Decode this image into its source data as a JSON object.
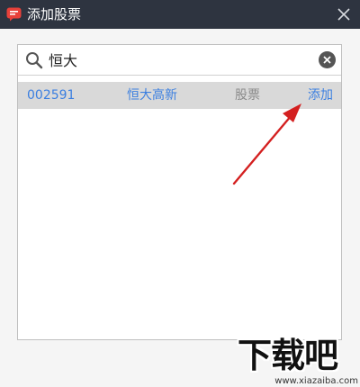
{
  "window": {
    "title": "添加股票",
    "close_icon": "close-icon",
    "app_icon": "chat-bubble-icon"
  },
  "search": {
    "value": "恒大",
    "icon": "search-icon",
    "clear_icon": "clear-icon"
  },
  "results": [
    {
      "code": "002591",
      "name": "恒大高新",
      "type": "股票",
      "action": "添加"
    }
  ],
  "watermark": {
    "main": "下载吧",
    "url": "www.xiazaiba.com"
  },
  "colors": {
    "titlebar": "#2e3440",
    "accent": "#3b7fe0",
    "row_bg": "#d9d9d9",
    "arrow": "#d42020"
  }
}
